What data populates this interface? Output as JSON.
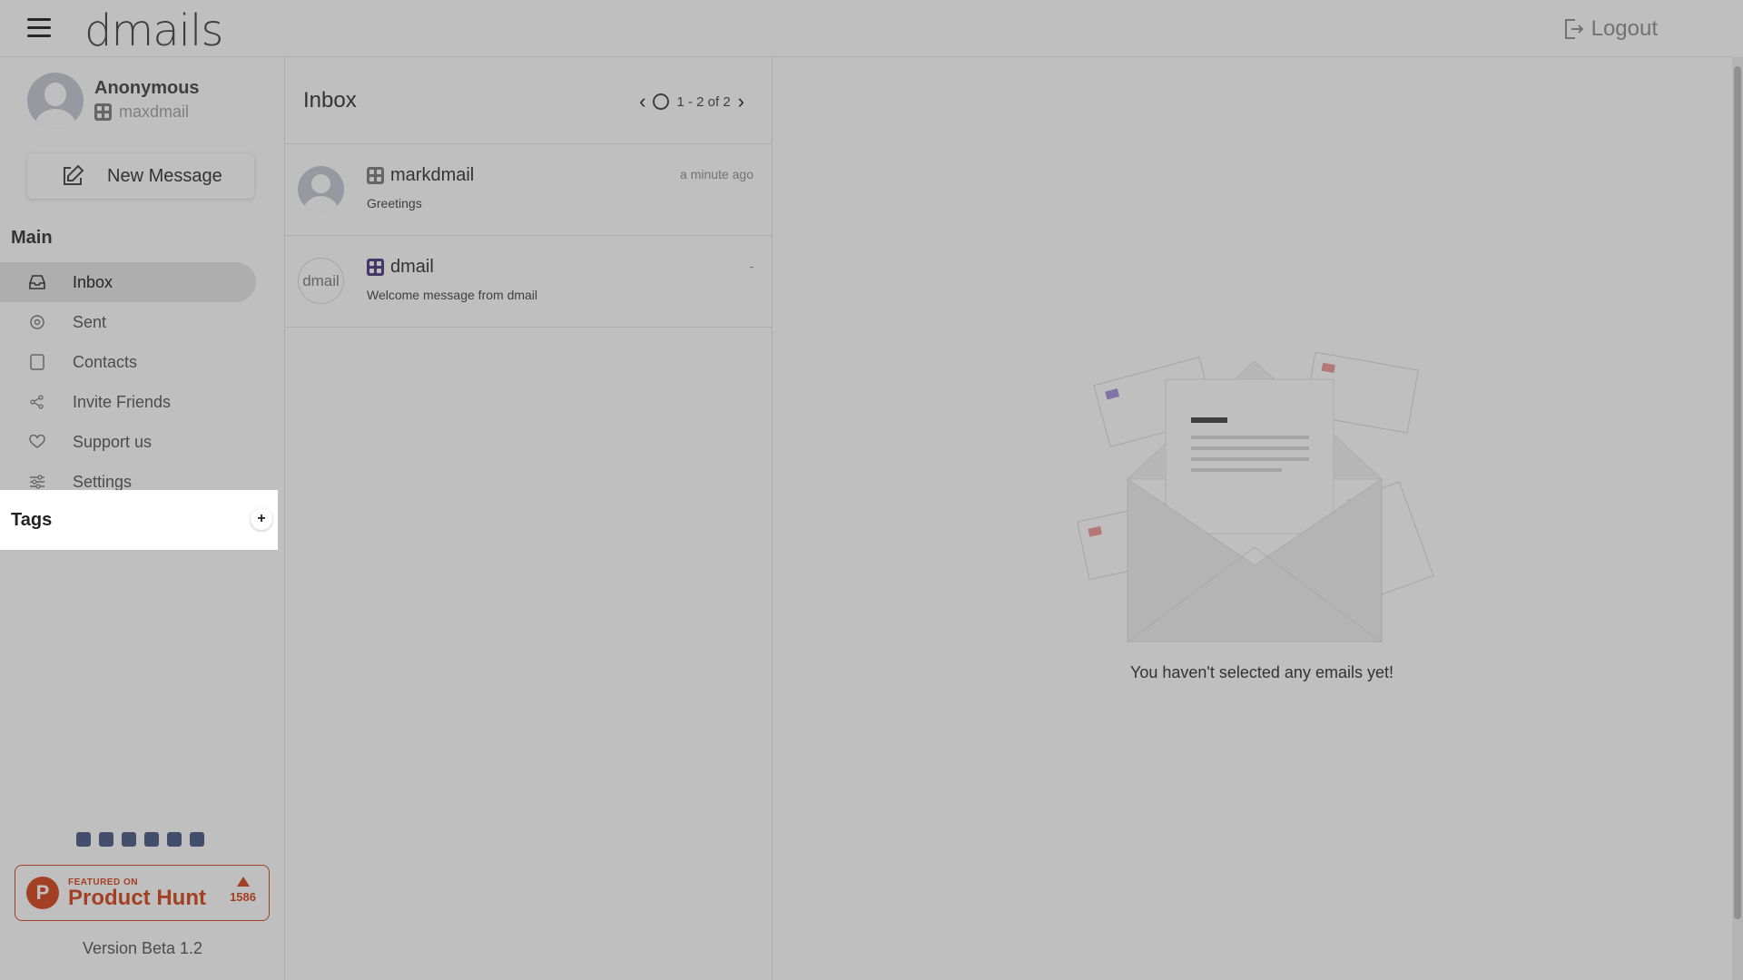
{
  "app": {
    "logo": "dmails",
    "logout_label": "Logout"
  },
  "profile": {
    "name": "Anonymous",
    "handle": "maxdmail"
  },
  "sidebar": {
    "new_message_label": "New Message",
    "main_title": "Main",
    "items": [
      {
        "label": "Inbox",
        "icon": "inbox-icon"
      },
      {
        "label": "Sent",
        "icon": "sent-icon"
      },
      {
        "label": "Contacts",
        "icon": "contacts-icon"
      },
      {
        "label": "Invite Friends",
        "icon": "share-icon"
      },
      {
        "label": "Support us",
        "icon": "heart-icon"
      },
      {
        "label": "Settings",
        "icon": "sliders-icon"
      }
    ],
    "tags_title": "Tags",
    "tags_add": "+",
    "product_hunt": {
      "small": "FEATURED ON",
      "big": "Product Hunt",
      "votes": "1586",
      "color": "#da552f"
    },
    "version": "Version Beta 1.2"
  },
  "list": {
    "title": "Inbox",
    "pager": "1 - 2 of 2",
    "messages": [
      {
        "sender": "markdmail",
        "preview": "Greetings",
        "time": "a minute ago"
      },
      {
        "sender": "dmail",
        "preview": "Welcome message from dmail",
        "time": "-"
      }
    ]
  },
  "reader": {
    "empty_text": "You haven't selected any emails yet!"
  }
}
